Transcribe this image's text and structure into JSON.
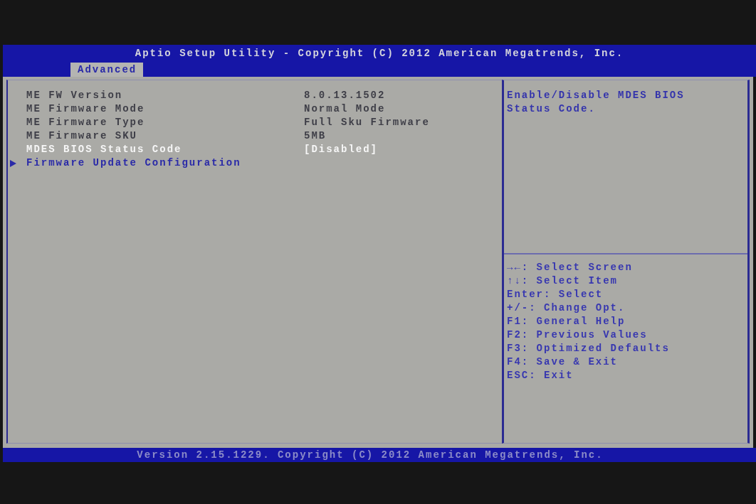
{
  "title_bar": {
    "title": "Aptio Setup Utility - Copyright (C) 2012 American Megatrends, Inc."
  },
  "tabs": [
    {
      "label": "Advanced",
      "selected": true
    }
  ],
  "settings": [
    {
      "kind": "info",
      "label": "ME FW Version",
      "value": "8.0.13.1502",
      "selected": false
    },
    {
      "kind": "info",
      "label": "ME Firmware Mode",
      "value": "Normal Mode",
      "selected": false
    },
    {
      "kind": "info",
      "label": "ME Firmware Type",
      "value": "Full Sku Firmware",
      "selected": false
    },
    {
      "kind": "info",
      "label": "ME Firmware SKU",
      "value": "5MB",
      "selected": false
    },
    {
      "kind": "option",
      "label": "MDES BIOS Status Code",
      "value": "[Disabled]",
      "selected": true
    },
    {
      "kind": "submenu",
      "label": "Firmware Update Configuration",
      "selected": false
    }
  ],
  "help": {
    "text": "Enable/Disable MDES BIOS Status Code."
  },
  "key_legend": [
    "→←: Select Screen",
    "↑↓: Select Item",
    "Enter: Select",
    "+/-: Change Opt.",
    "F1: General Help",
    "F2: Previous Values",
    "F3: Optimized Defaults",
    "F4: Save & Exit",
    "ESC: Exit"
  ],
  "status_bar": {
    "text": "Version 2.15.1229. Copyright (C) 2012 American Megatrends, Inc."
  }
}
